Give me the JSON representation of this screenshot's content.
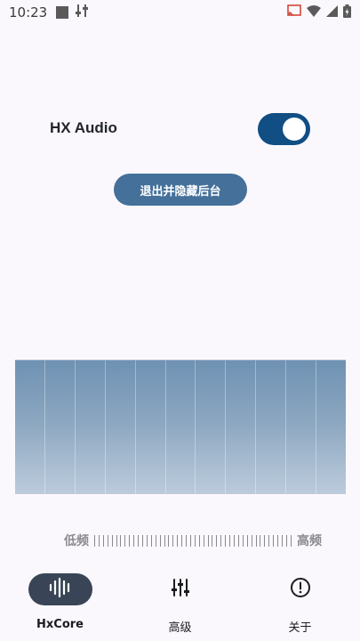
{
  "status_bar": {
    "time": "10:23"
  },
  "main": {
    "toggle_label": "HX Audio",
    "toggle_on": true,
    "exit_button_label": "退出并隐藏后台"
  },
  "eq": {
    "band_count": 11,
    "low_label": "低频",
    "high_label": "高频"
  },
  "nav": {
    "items": [
      {
        "label": "HxCore",
        "icon": "waveform-icon",
        "active": true
      },
      {
        "label": "高级",
        "icon": "sliders-icon",
        "active": false
      },
      {
        "label": "关于",
        "icon": "info-icon",
        "active": false
      }
    ]
  },
  "colors": {
    "accent": "#104e84",
    "button": "#44709a",
    "nav_active": "#394556",
    "background": "#fbf8fd"
  }
}
